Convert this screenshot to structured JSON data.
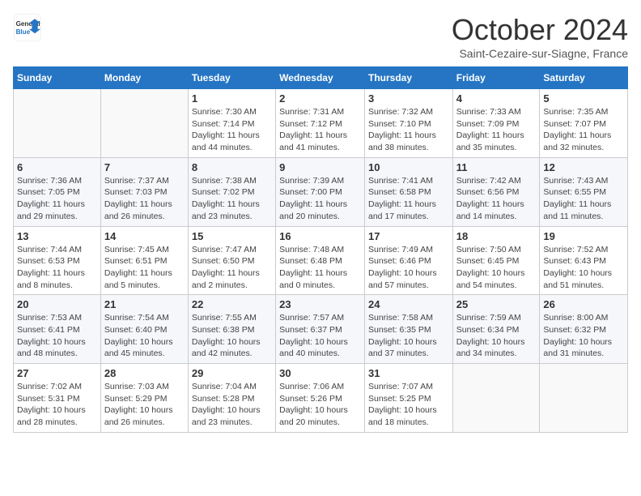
{
  "header": {
    "logo_general": "General",
    "logo_blue": "Blue",
    "month_title": "October 2024",
    "subtitle": "Saint-Cezaire-sur-Siagne, France"
  },
  "days_of_week": [
    "Sunday",
    "Monday",
    "Tuesday",
    "Wednesday",
    "Thursday",
    "Friday",
    "Saturday"
  ],
  "weeks": [
    [
      {
        "day": "",
        "info": ""
      },
      {
        "day": "",
        "info": ""
      },
      {
        "day": "1",
        "info": "Sunrise: 7:30 AM\nSunset: 7:14 PM\nDaylight: 11 hours and 44 minutes."
      },
      {
        "day": "2",
        "info": "Sunrise: 7:31 AM\nSunset: 7:12 PM\nDaylight: 11 hours and 41 minutes."
      },
      {
        "day": "3",
        "info": "Sunrise: 7:32 AM\nSunset: 7:10 PM\nDaylight: 11 hours and 38 minutes."
      },
      {
        "day": "4",
        "info": "Sunrise: 7:33 AM\nSunset: 7:09 PM\nDaylight: 11 hours and 35 minutes."
      },
      {
        "day": "5",
        "info": "Sunrise: 7:35 AM\nSunset: 7:07 PM\nDaylight: 11 hours and 32 minutes."
      }
    ],
    [
      {
        "day": "6",
        "info": "Sunrise: 7:36 AM\nSunset: 7:05 PM\nDaylight: 11 hours and 29 minutes."
      },
      {
        "day": "7",
        "info": "Sunrise: 7:37 AM\nSunset: 7:03 PM\nDaylight: 11 hours and 26 minutes."
      },
      {
        "day": "8",
        "info": "Sunrise: 7:38 AM\nSunset: 7:02 PM\nDaylight: 11 hours and 23 minutes."
      },
      {
        "day": "9",
        "info": "Sunrise: 7:39 AM\nSunset: 7:00 PM\nDaylight: 11 hours and 20 minutes."
      },
      {
        "day": "10",
        "info": "Sunrise: 7:41 AM\nSunset: 6:58 PM\nDaylight: 11 hours and 17 minutes."
      },
      {
        "day": "11",
        "info": "Sunrise: 7:42 AM\nSunset: 6:56 PM\nDaylight: 11 hours and 14 minutes."
      },
      {
        "day": "12",
        "info": "Sunrise: 7:43 AM\nSunset: 6:55 PM\nDaylight: 11 hours and 11 minutes."
      }
    ],
    [
      {
        "day": "13",
        "info": "Sunrise: 7:44 AM\nSunset: 6:53 PM\nDaylight: 11 hours and 8 minutes."
      },
      {
        "day": "14",
        "info": "Sunrise: 7:45 AM\nSunset: 6:51 PM\nDaylight: 11 hours and 5 minutes."
      },
      {
        "day": "15",
        "info": "Sunrise: 7:47 AM\nSunset: 6:50 PM\nDaylight: 11 hours and 2 minutes."
      },
      {
        "day": "16",
        "info": "Sunrise: 7:48 AM\nSunset: 6:48 PM\nDaylight: 11 hours and 0 minutes."
      },
      {
        "day": "17",
        "info": "Sunrise: 7:49 AM\nSunset: 6:46 PM\nDaylight: 10 hours and 57 minutes."
      },
      {
        "day": "18",
        "info": "Sunrise: 7:50 AM\nSunset: 6:45 PM\nDaylight: 10 hours and 54 minutes."
      },
      {
        "day": "19",
        "info": "Sunrise: 7:52 AM\nSunset: 6:43 PM\nDaylight: 10 hours and 51 minutes."
      }
    ],
    [
      {
        "day": "20",
        "info": "Sunrise: 7:53 AM\nSunset: 6:41 PM\nDaylight: 10 hours and 48 minutes."
      },
      {
        "day": "21",
        "info": "Sunrise: 7:54 AM\nSunset: 6:40 PM\nDaylight: 10 hours and 45 minutes."
      },
      {
        "day": "22",
        "info": "Sunrise: 7:55 AM\nSunset: 6:38 PM\nDaylight: 10 hours and 42 minutes."
      },
      {
        "day": "23",
        "info": "Sunrise: 7:57 AM\nSunset: 6:37 PM\nDaylight: 10 hours and 40 minutes."
      },
      {
        "day": "24",
        "info": "Sunrise: 7:58 AM\nSunset: 6:35 PM\nDaylight: 10 hours and 37 minutes."
      },
      {
        "day": "25",
        "info": "Sunrise: 7:59 AM\nSunset: 6:34 PM\nDaylight: 10 hours and 34 minutes."
      },
      {
        "day": "26",
        "info": "Sunrise: 8:00 AM\nSunset: 6:32 PM\nDaylight: 10 hours and 31 minutes."
      }
    ],
    [
      {
        "day": "27",
        "info": "Sunrise: 7:02 AM\nSunset: 5:31 PM\nDaylight: 10 hours and 28 minutes."
      },
      {
        "day": "28",
        "info": "Sunrise: 7:03 AM\nSunset: 5:29 PM\nDaylight: 10 hours and 26 minutes."
      },
      {
        "day": "29",
        "info": "Sunrise: 7:04 AM\nSunset: 5:28 PM\nDaylight: 10 hours and 23 minutes."
      },
      {
        "day": "30",
        "info": "Sunrise: 7:06 AM\nSunset: 5:26 PM\nDaylight: 10 hours and 20 minutes."
      },
      {
        "day": "31",
        "info": "Sunrise: 7:07 AM\nSunset: 5:25 PM\nDaylight: 10 hours and 18 minutes."
      },
      {
        "day": "",
        "info": ""
      },
      {
        "day": "",
        "info": ""
      }
    ]
  ]
}
